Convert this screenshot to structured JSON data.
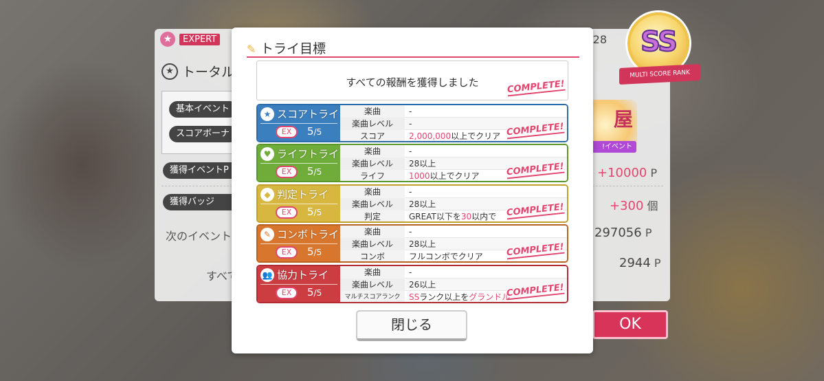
{
  "background": {
    "difficulty": "EXPERT",
    "rank_value_partial": "28",
    "total_heading_partial": "トータル",
    "basic_event_partial": "基本イベント",
    "score_bonus_partial": "スコアボーナ",
    "earned_event_partial": "獲得イベントP",
    "earned_badge": "獲得バッジ",
    "earned_event_value": "+10000",
    "earned_event_unit": "P",
    "earned_badge_value": "+300",
    "earned_badge_unit": "個",
    "next_event_partial": "次のイベント",
    "next_event_value": "297056",
    "next_event_unit": "P",
    "subvalue": "2944",
    "subvalue_unit": "P",
    "all_partial": "すべて",
    "rank_badge_text": "SS",
    "rank_badge_ribbon": "MULTI SCORE RANK",
    "event_tag": "!イベント",
    "event_logo": "屋",
    "ok_button": "OK"
  },
  "modal": {
    "title": "トライ目標",
    "reward_text": "すべての報酬を獲得しました",
    "complete_label": "COMPLETE!",
    "close_button": "閉じる",
    "tries": [
      {
        "name": "スコアトライ",
        "icon": "★",
        "ex": "EX",
        "progress": "5",
        "total": "/5",
        "color": "#3c7fbf",
        "border": "#2d6aa8",
        "rows": [
          {
            "label": "楽曲",
            "value": "-"
          },
          {
            "label": "楽曲レベル",
            "value": "-"
          },
          {
            "label": "スコア",
            "value_pink": "2,000,000",
            "value": "以上でクリア"
          }
        ]
      },
      {
        "name": "ライフトライ",
        "icon": "♥",
        "ex": "EX",
        "progress": "5",
        "total": "/5",
        "color": "#6fac3a",
        "border": "#5a9629",
        "rows": [
          {
            "label": "楽曲",
            "value": "-"
          },
          {
            "label": "楽曲レベル",
            "value": "28以上"
          },
          {
            "label": "ライフ",
            "value_pink": "1000",
            "value": "以上でクリア"
          }
        ]
      },
      {
        "name": "判定トライ",
        "icon": "◆",
        "ex": "EX",
        "progress": "5",
        "total": "/5",
        "color": "#d8b740",
        "border": "#c29e2a",
        "rows": [
          {
            "label": "楽曲",
            "value": "-"
          },
          {
            "label": "楽曲レベル",
            "value": "28以上"
          },
          {
            "label": "判定",
            "value_pre": "GREAT以下を",
            "value_pink": "30",
            "value": "以内で"
          }
        ]
      },
      {
        "name": "コンボトライ",
        "icon": "✎",
        "ex": "EX",
        "progress": "5",
        "total": "/5",
        "color": "#d9762d",
        "border": "#b8621f",
        "rows": [
          {
            "label": "楽曲",
            "value": "-"
          },
          {
            "label": "楽曲レベル",
            "value": "28以上"
          },
          {
            "label": "コンボ",
            "value": "フルコンボでクリア"
          }
        ]
      },
      {
        "name": "協力トライ",
        "icon": "👥",
        "ex": "EX",
        "progress": "5",
        "total": "/5",
        "color": "#cc3d42",
        "border": "#b02c32",
        "rows": [
          {
            "label": "楽曲",
            "value": "-"
          },
          {
            "label": "楽曲レベル",
            "value": "26以上"
          },
          {
            "label": "マルチスコアランク",
            "value_pre": "SS",
            "value": "ランク以上を",
            "value_pink": "グランドル"
          }
        ]
      }
    ]
  }
}
